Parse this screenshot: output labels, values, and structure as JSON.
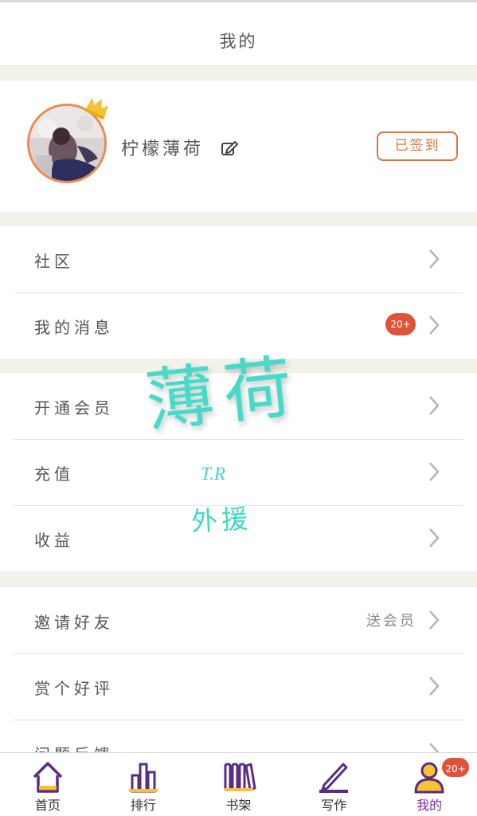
{
  "header": {
    "title": "我的"
  },
  "profile": {
    "username": "柠檬薄荷",
    "checkin_label": "已签到"
  },
  "groups": [
    [
      {
        "label": "社区"
      },
      {
        "label": "我的消息",
        "badge": "20+"
      }
    ],
    [
      {
        "label": "开通会员"
      },
      {
        "label": "充值"
      },
      {
        "label": "收益"
      }
    ],
    [
      {
        "label": "邀请好友",
        "extra": "送会员"
      },
      {
        "label": "赏个好评"
      }
    ]
  ],
  "partial_row_label": "问题反馈",
  "watermark": {
    "main": "薄荷",
    "sig": "T.R",
    "sub": "外援"
  },
  "tabs": [
    {
      "label": "首页",
      "icon": "home-icon"
    },
    {
      "label": "排行",
      "icon": "ranking-icon"
    },
    {
      "label": "书架",
      "icon": "bookshelf-icon"
    },
    {
      "label": "写作",
      "icon": "pen-icon"
    },
    {
      "label": "我的",
      "icon": "profile-icon",
      "active": true,
      "badge": "20+"
    }
  ],
  "colors": {
    "accent": "#e0733b",
    "badge": "#e0533b",
    "tab_active": "#7a2ea8",
    "watermark": "#3dd9c6",
    "crown": "#f5c231"
  }
}
